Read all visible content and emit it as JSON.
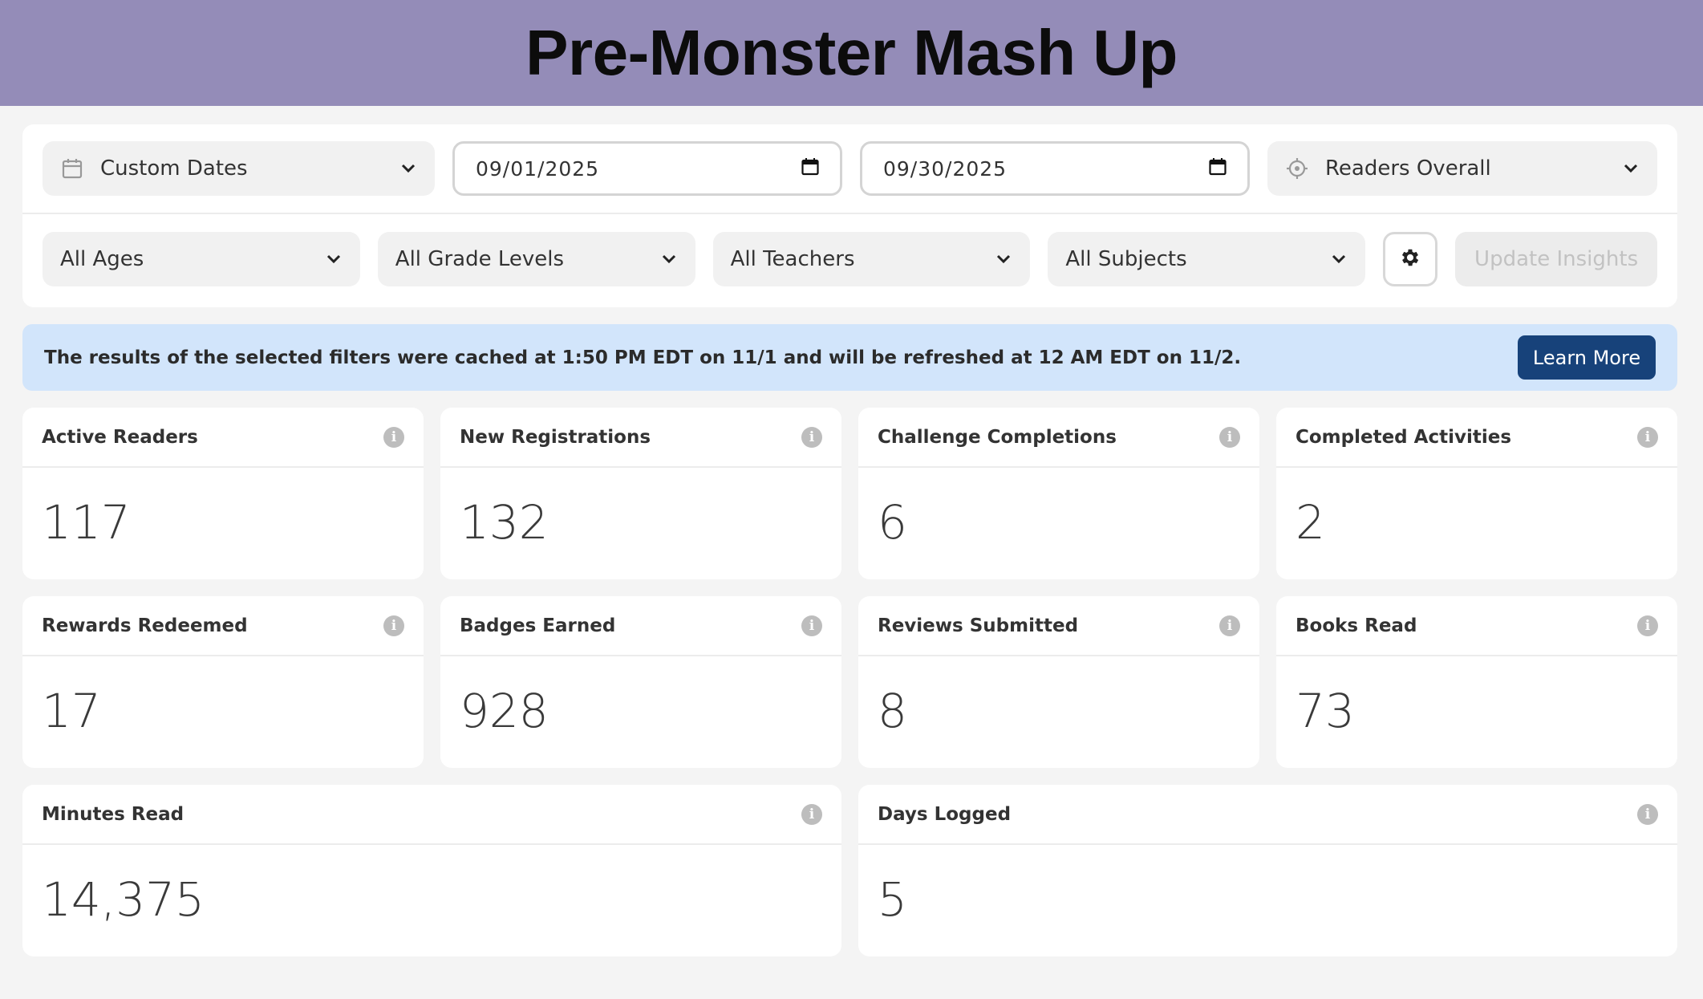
{
  "header": {
    "title": "Pre-Monster Mash Up"
  },
  "filters": {
    "date_range": {
      "label": "Custom Dates",
      "icon": "calendar-icon"
    },
    "start_date": "09/01/2025",
    "end_date": "09/30/2025",
    "view": {
      "label": "Readers Overall",
      "icon": "target-icon"
    },
    "ages": "All Ages",
    "grade_levels": "All Grade Levels",
    "teachers": "All Teachers",
    "subjects": "All Subjects",
    "settings_icon": "gear-icon",
    "update_label": "Update Insights"
  },
  "notice": {
    "message": "The results of the selected filters were cached at 1:50 PM EDT on 11/1 and will be refreshed at 12 AM EDT on 11/2.",
    "button_label": "Learn More",
    "background": "#d2e5fb",
    "button_color": "#17427a"
  },
  "stats": [
    {
      "title": "Active Readers",
      "value": "117"
    },
    {
      "title": "New Registrations",
      "value": "132"
    },
    {
      "title": "Challenge Completions",
      "value": "6"
    },
    {
      "title": "Completed Activities",
      "value": "2"
    },
    {
      "title": "Rewards Redeemed",
      "value": "17"
    },
    {
      "title": "Badges Earned",
      "value": "928"
    },
    {
      "title": "Reviews Submitted",
      "value": "8"
    },
    {
      "title": "Books Read",
      "value": "73"
    },
    {
      "title": "Minutes Read",
      "value": "14,375"
    },
    {
      "title": "Days Logged",
      "value": "5"
    }
  ],
  "colors": {
    "header_bg": "#948cb8",
    "page_bg": "#f4f4f4"
  }
}
